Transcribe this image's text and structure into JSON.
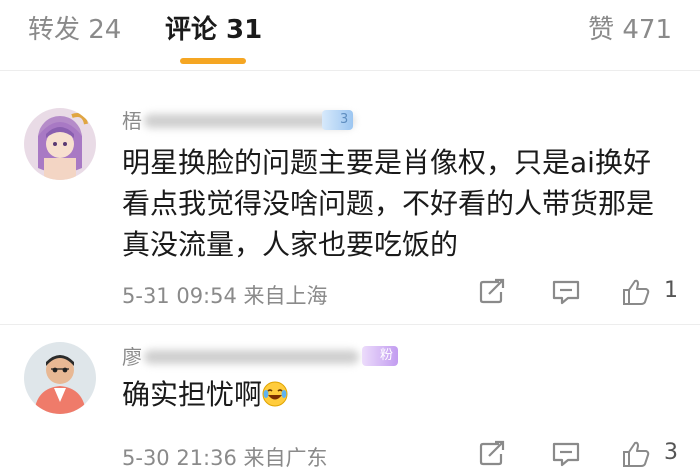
{
  "tabs": {
    "repost": "转发 24",
    "comments": "评论 31",
    "likes": "赞 471"
  },
  "comments": [
    {
      "name_initial": "梧",
      "fan_badge": "3",
      "text_lines": [
        "明星换脸的问题主要是肖像权，只是ai换好",
        "看点我觉得没啥问题，不好看的人带货那是",
        "真没流量，人家也要吃饭的"
      ],
      "time": "5-31 09:54",
      "location": "来自上海",
      "likes": "1"
    },
    {
      "name_initial": "廖",
      "fan_badge": "粉2",
      "text": "确实担忧啊",
      "emoji": "laughing-crying-emoji",
      "time": "5-30 21:36",
      "location": "来自广东",
      "likes": "3"
    }
  ],
  "colors": {
    "accent": "#f5a623",
    "muted": "#8a8a8a"
  }
}
